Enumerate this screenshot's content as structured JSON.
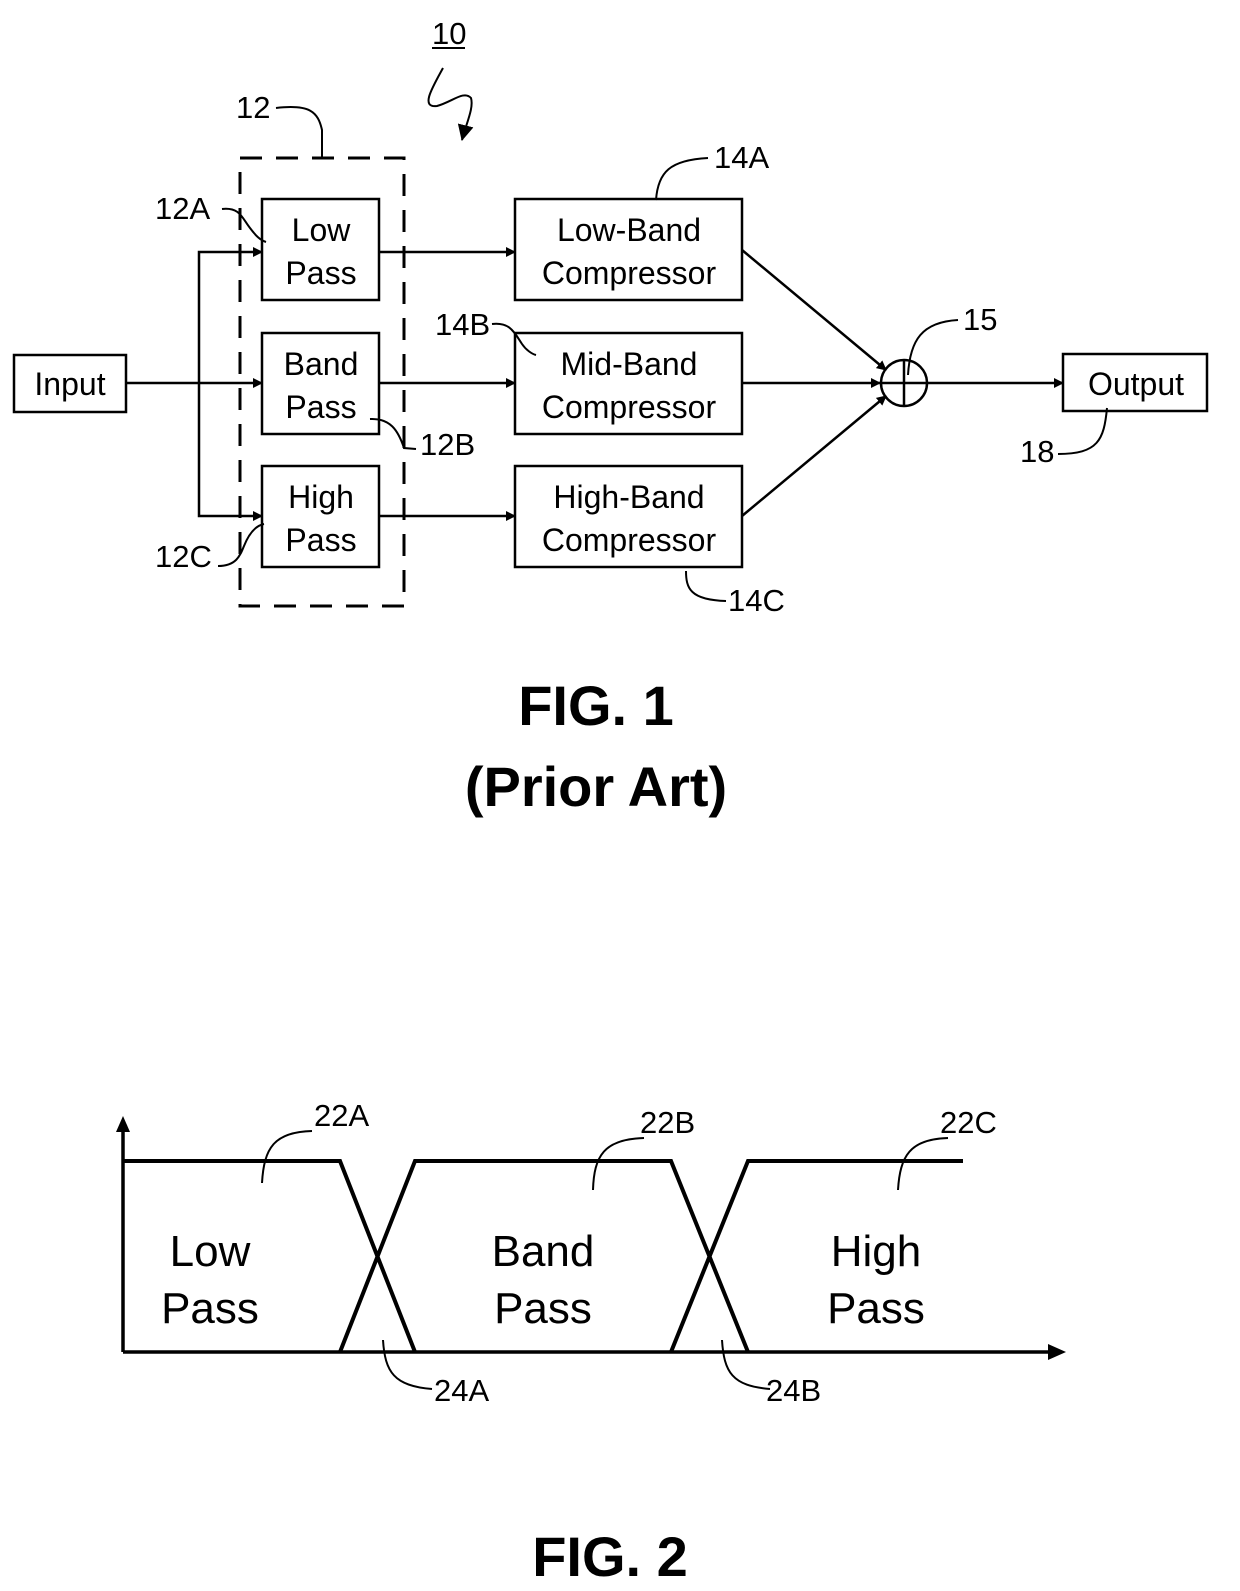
{
  "fig1": {
    "ref_system": "10",
    "ref_filter_bank": "12",
    "filters": [
      {
        "ref": "12A",
        "line1": "Low",
        "line2": "Pass"
      },
      {
        "ref": "12B",
        "line1": "Band",
        "line2": "Pass"
      },
      {
        "ref": "12C",
        "line1": "High",
        "line2": "Pass"
      }
    ],
    "compressors": [
      {
        "ref": "14A",
        "line1": "Low-Band",
        "line2": "Compressor"
      },
      {
        "ref": "14B",
        "line1": "Mid-Band",
        "line2": "Compressor"
      },
      {
        "ref": "14C",
        "line1": "High-Band",
        "line2": "Compressor"
      }
    ],
    "input_label": "Input",
    "summer_ref": "15",
    "output_label": "Output",
    "output_ref": "18",
    "caption_line1": "FIG. 1",
    "caption_line2": "(Prior Art)"
  },
  "fig2": {
    "bands": [
      {
        "ref": "22A",
        "line1": "Low",
        "line2": "Pass"
      },
      {
        "ref": "22B",
        "line1": "Band",
        "line2": "Pass"
      },
      {
        "ref": "22C",
        "line1": "High",
        "line2": "Pass"
      }
    ],
    "crossovers": [
      {
        "ref": "24A"
      },
      {
        "ref": "24B"
      }
    ],
    "caption": "FIG. 2"
  }
}
